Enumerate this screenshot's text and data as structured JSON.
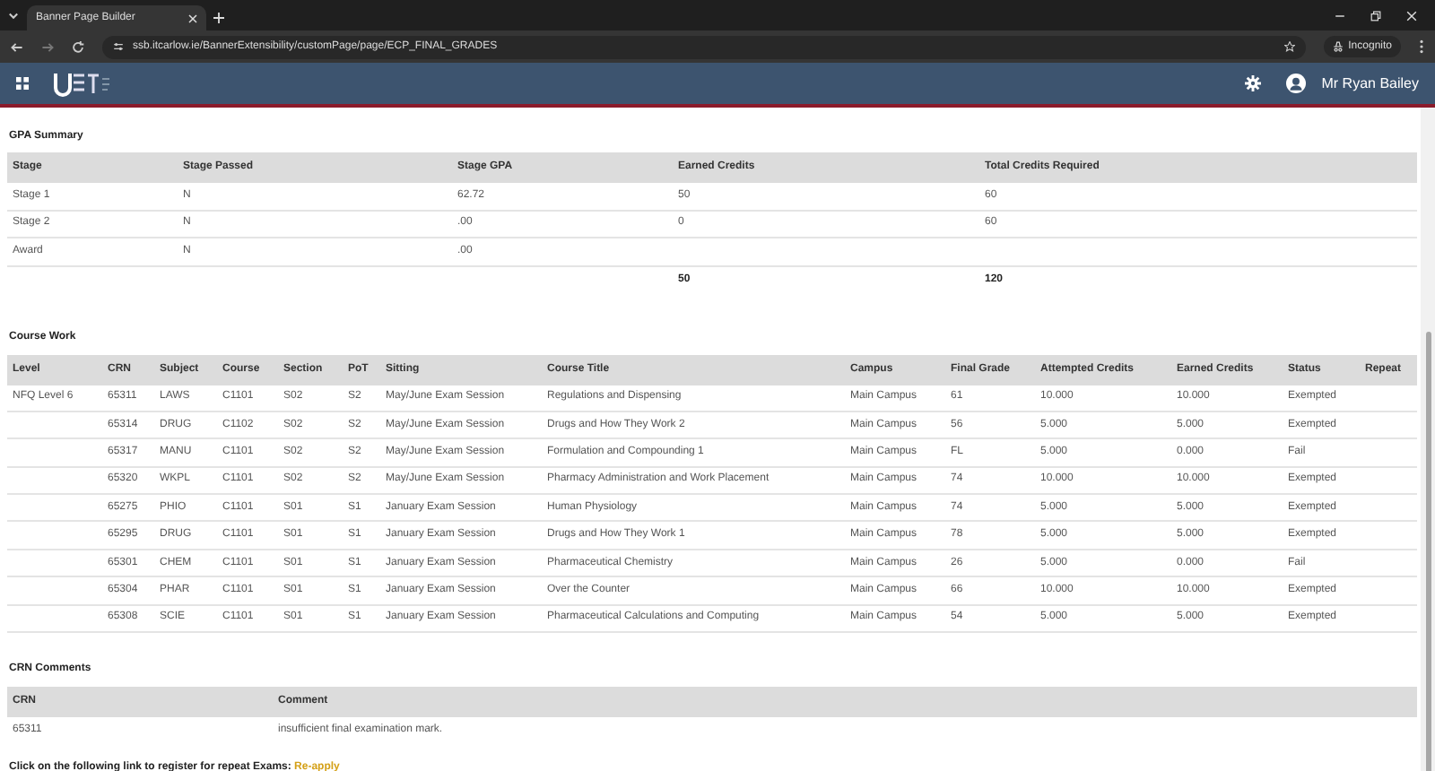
{
  "browser": {
    "tab_title": "Banner Page Builder",
    "url": "ssb.itcarlow.ie/BannerExtensibility/customPage/page/ECP_FINAL_GRADES",
    "incognito_label": "Incognito"
  },
  "header": {
    "user_name": "Mr Ryan Bailey"
  },
  "gpa_summary": {
    "title": "GPA Summary",
    "columns": [
      "Stage",
      "Stage Passed",
      "Stage GPA",
      "Earned Credits",
      "Total Credits Required"
    ],
    "rows": [
      [
        "Stage 1",
        "N",
        "62.72",
        "50",
        "60"
      ],
      [
        "Stage 2",
        "N",
        ".00",
        "0",
        "60"
      ],
      [
        "Award",
        "N",
        ".00",
        null,
        null
      ]
    ],
    "totals": {
      "earned_credits": "50",
      "total_credits_required": "120"
    }
  },
  "course_work": {
    "title": "Course Work",
    "columns": [
      "Level",
      "CRN",
      "Subject",
      "Course",
      "Section",
      "PoT",
      "Sitting",
      "Course Title",
      "Campus",
      "Final Grade",
      "Attempted Credits",
      "Earned Credits",
      "Status",
      "Repeat"
    ],
    "rows": [
      [
        "NFQ Level 6",
        "65311",
        "LAWS",
        "C1101",
        "S02",
        "S2",
        "May/June Exam Session",
        "Regulations and Dispensing",
        "Main Campus",
        "61",
        "10.000",
        "10.000",
        "Exempted",
        null
      ],
      [
        null,
        "65314",
        "DRUG",
        "C1102",
        "S02",
        "S2",
        "May/June Exam Session",
        "Drugs and How They Work 2",
        "Main Campus",
        "56",
        "5.000",
        "5.000",
        "Exempted",
        null
      ],
      [
        null,
        "65317",
        "MANU",
        "C1101",
        "S02",
        "S2",
        "May/June Exam Session",
        "Formulation and Compounding 1",
        "Main Campus",
        "FL",
        "5.000",
        "0.000",
        "Fail",
        null
      ],
      [
        null,
        "65320",
        "WKPL",
        "C1101",
        "S02",
        "S2",
        "May/June Exam Session",
        "Pharmacy Administration and Work Placement",
        "Main Campus",
        "74",
        "10.000",
        "10.000",
        "Exempted",
        null
      ],
      [
        null,
        "65275",
        "PHIO",
        "C1101",
        "S01",
        "S1",
        "January Exam Session",
        "Human Physiology",
        "Main Campus",
        "74",
        "5.000",
        "5.000",
        "Exempted",
        null
      ],
      [
        null,
        "65295",
        "DRUG",
        "C1101",
        "S01",
        "S1",
        "January Exam Session",
        "Drugs and How They Work 1",
        "Main Campus",
        "78",
        "5.000",
        "5.000",
        "Exempted",
        null
      ],
      [
        null,
        "65301",
        "CHEM",
        "C1101",
        "S01",
        "S1",
        "January Exam Session",
        "Pharmaceutical Chemistry",
        "Main Campus",
        "26",
        "5.000",
        "0.000",
        "Fail",
        null
      ],
      [
        null,
        "65304",
        "PHAR",
        "C1101",
        "S01",
        "S1",
        "January Exam Session",
        "Over the Counter",
        "Main Campus",
        "66",
        "10.000",
        "10.000",
        "Exempted",
        null
      ],
      [
        null,
        "65308",
        "SCIE",
        "C1101",
        "S01",
        "S1",
        "January Exam Session",
        "Pharmaceutical Calculations and Computing",
        "Main Campus",
        "54",
        "5.000",
        "5.000",
        "Exempted",
        null
      ]
    ]
  },
  "crn_comments": {
    "title": "CRN Comments",
    "columns": [
      "CRN",
      "Comment"
    ],
    "rows": [
      [
        "65311",
        "insufficient final examination mark."
      ]
    ]
  },
  "repeat": {
    "text": "Click on the following link to register for repeat Exams:",
    "link": "Re-apply"
  }
}
